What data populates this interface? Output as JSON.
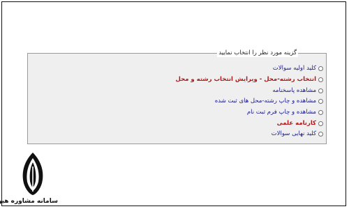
{
  "form": {
    "legend": "گزینه مورد نظر را انتخاب نمایید",
    "options": [
      {
        "label": "کلید اولیه سوالات",
        "style": "normal"
      },
      {
        "label": "انتخاب رشته-محل - ویرایش انتخاب رشته و محل",
        "style": "bold-red"
      },
      {
        "label": "مشاهده پاسخنامه",
        "style": "normal"
      },
      {
        "label": "مشاهده و چاپ رشته-محل های ثبت شده",
        "style": "normal"
      },
      {
        "label": "مشاهده و چاپ فرم ثبت نام",
        "style": "normal"
      },
      {
        "label": "کارنامه علمی",
        "style": "bold-red"
      },
      {
        "label": "کلید نهایی سوالات",
        "style": "normal"
      }
    ]
  },
  "logo": {
    "text": "سامانه مشاوره هیوا"
  },
  "colors": {
    "link_blue": "#1a1a8c",
    "highlight_red": "#b01818",
    "panel_bg": "#efefef"
  }
}
